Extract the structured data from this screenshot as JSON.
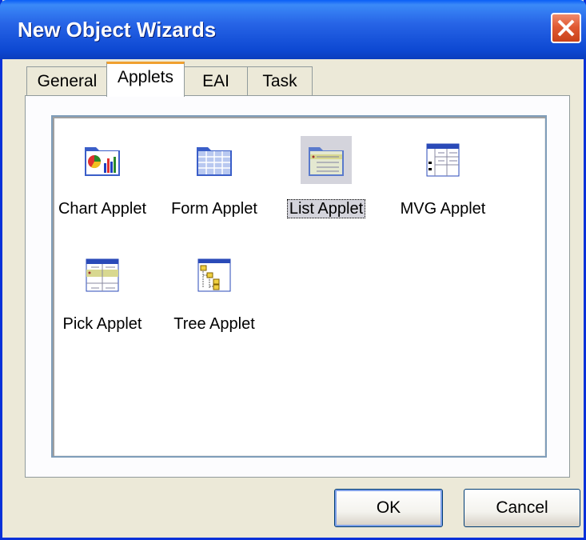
{
  "window": {
    "title": "New Object Wizards"
  },
  "tabs": [
    {
      "label": "General"
    },
    {
      "label": "Applets"
    },
    {
      "label": "EAI"
    },
    {
      "label": "Task"
    }
  ],
  "active_tab": "Applets",
  "items": [
    {
      "label": "Chart Applet",
      "icon": "chart-applet-icon"
    },
    {
      "label": "Form Applet",
      "icon": "form-applet-icon"
    },
    {
      "label": "List Applet",
      "icon": "list-applet-icon"
    },
    {
      "label": "MVG Applet",
      "icon": "mvg-applet-icon"
    },
    {
      "label": "Pick Applet",
      "icon": "pick-applet-icon"
    },
    {
      "label": "Tree Applet",
      "icon": "tree-applet-icon"
    }
  ],
  "selected_item": "List Applet",
  "buttons": {
    "ok": "OK",
    "cancel": "Cancel"
  },
  "colors": {
    "titlebar": "#0d48d2",
    "dialog_bg": "#ece9d8",
    "close": "#e05a33"
  }
}
